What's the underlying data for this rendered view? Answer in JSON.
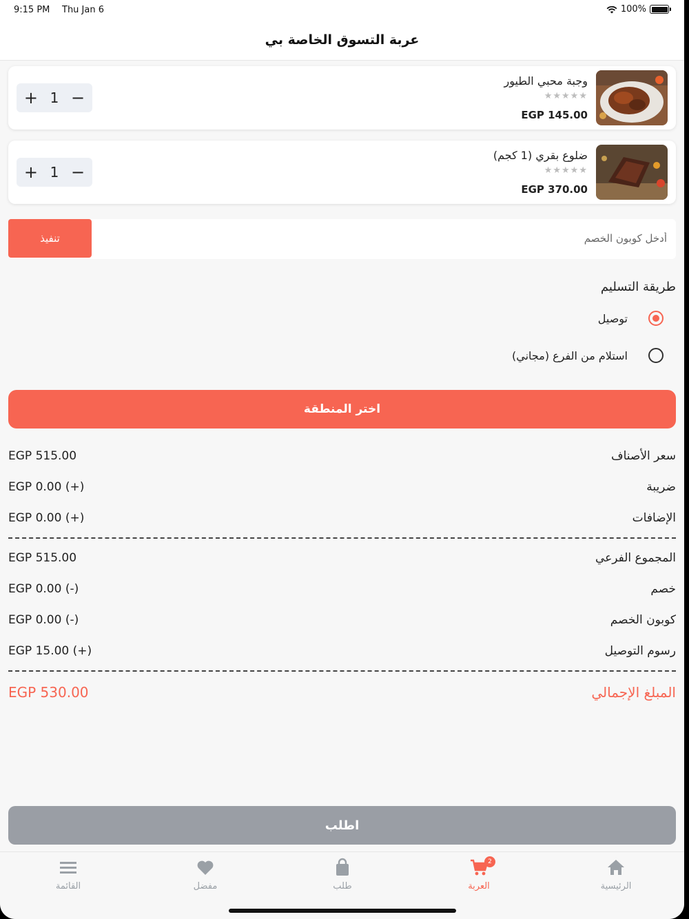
{
  "status_bar": {
    "time": "9:15 PM",
    "date": "Thu Jan 6",
    "battery": "100%"
  },
  "header": {
    "title": "عربة التسوق الخاصة بي"
  },
  "cart_items": [
    {
      "name": "وجبة محبي الطيور",
      "stars": "★★★★★",
      "price": "EGP 145.00",
      "quantity": "1",
      "plus": "+",
      "minus": "−"
    },
    {
      "name": "ضلوع بقري (1 كجم)",
      "stars": "★★★★★",
      "price": "EGP 370.00",
      "quantity": "1",
      "plus": "+",
      "minus": "−"
    }
  ],
  "coupon": {
    "placeholder": "أدخل كوبون الخصم",
    "apply_label": "تنفيذ"
  },
  "delivery": {
    "title": "طريقة التسليم",
    "options": [
      {
        "label": "توصيل",
        "selected": true
      },
      {
        "label": "استلام من الفرع (مجاني)",
        "selected": false
      }
    ]
  },
  "region_button_label": "اختر المنطقة",
  "summary": {
    "items_price": {
      "label": "سعر الأصناف",
      "value": "EGP 515.00"
    },
    "tax": {
      "label": "ضريبة",
      "value": "EGP 0.00 (+)"
    },
    "addons": {
      "label": "الإضافات",
      "value": "EGP 0.00 (+)"
    },
    "subtotal": {
      "label": "المجموع الفرعي",
      "value": "EGP 515.00"
    },
    "discount": {
      "label": "خصم",
      "value": "EGP 0.00 (-)"
    },
    "coupon_discount": {
      "label": "كوبون الخصم",
      "value": "EGP 0.00 (-)"
    },
    "delivery_fee": {
      "label": "رسوم التوصيل",
      "value": "EGP 15.00 (+)"
    },
    "total": {
      "label": "المبلغ الإجمالي",
      "value": "EGP 530.00"
    }
  },
  "order_button_label": "اطلب",
  "tabs": {
    "menu": {
      "label": "القائمة",
      "icon": "menu-icon"
    },
    "favorites": {
      "label": "مفضل",
      "icon": "heart-icon"
    },
    "orders": {
      "label": "طلب",
      "icon": "bag-icon"
    },
    "cart": {
      "label": "العربة",
      "icon": "cart-icon",
      "badge": "2"
    },
    "home": {
      "label": "الرئيسية",
      "icon": "home-icon"
    }
  },
  "colors": {
    "accent": "#f76552",
    "disabled_button": "#9a9ea5",
    "background": "#f7f7f7"
  }
}
